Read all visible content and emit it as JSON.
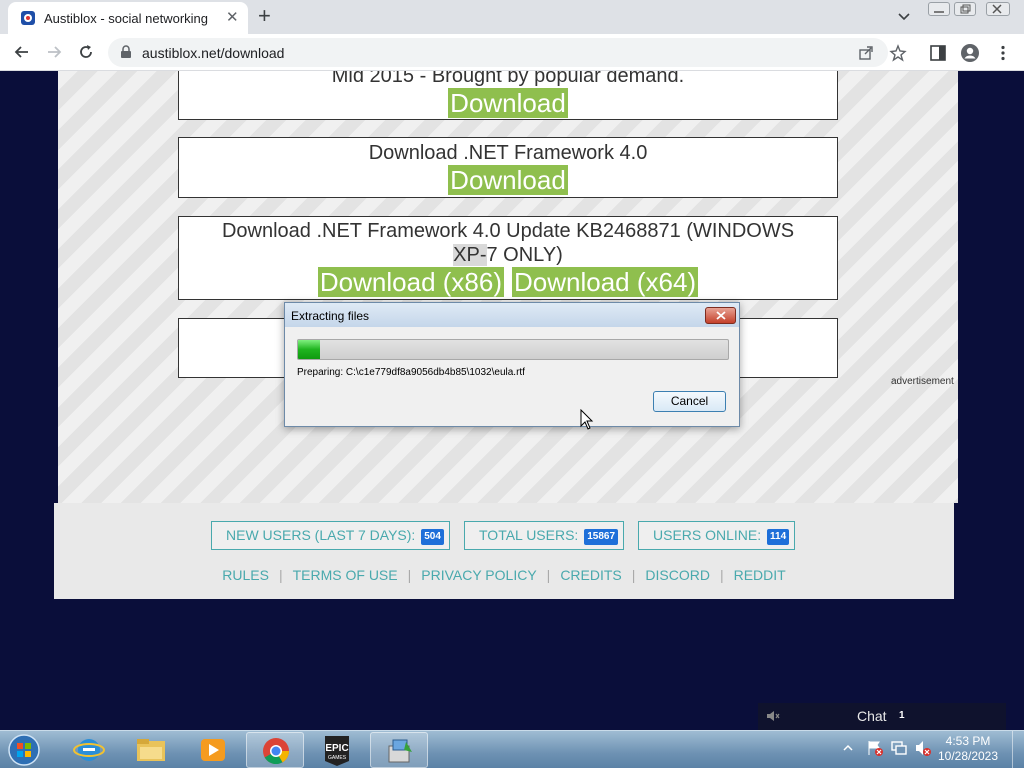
{
  "browser": {
    "tab_title": "Austiblox - social networking",
    "url": "austiblox.net/download"
  },
  "page": {
    "partial_heading": "Mid 2015 - Brought by popular demand.",
    "partial_download": "Download",
    "netfx_heading": "Download .NET Framework 4.0",
    "netfx_download": "Download",
    "kb_heading_1": "Download .NET Framework 4.0 Update KB2468871 (WINDOWS",
    "kb_heading_2_highlight": "XP-",
    "kb_heading_2_rest": "7 ONLY)",
    "kb_download_x86": "Download (x86)",
    "kb_download_x64": "Download (x64)",
    "ad_label": "advertisement"
  },
  "footer": {
    "stats": [
      {
        "label": "NEW USERS (LAST 7 DAYS):",
        "count": "504"
      },
      {
        "label": "TOTAL USERS:",
        "count": "15867"
      },
      {
        "label": "USERS ONLINE:",
        "count": "114"
      }
    ],
    "links": [
      "RULES",
      "TERMS OF USE",
      "PRIVACY POLICY",
      "CREDITS",
      "DISCORD",
      "REDDIT"
    ]
  },
  "chat": {
    "label": "Chat",
    "count": "1"
  },
  "dialog": {
    "title": "Extracting files",
    "progress": 0.05,
    "status": "Preparing: C:\\c1e779df8a9056db4b85\\1032\\eula.rtf",
    "cancel_label": "Cancel"
  },
  "taskbar": {
    "time": "4:53 PM",
    "date": "10/28/2023",
    "epic_label": "EPIC",
    "epic_sublabel": "GAMES"
  },
  "colors": {
    "download_green": "#8fbf4e",
    "footer_teal": "#49a9ad",
    "page_bg": "#0a0e3a"
  }
}
